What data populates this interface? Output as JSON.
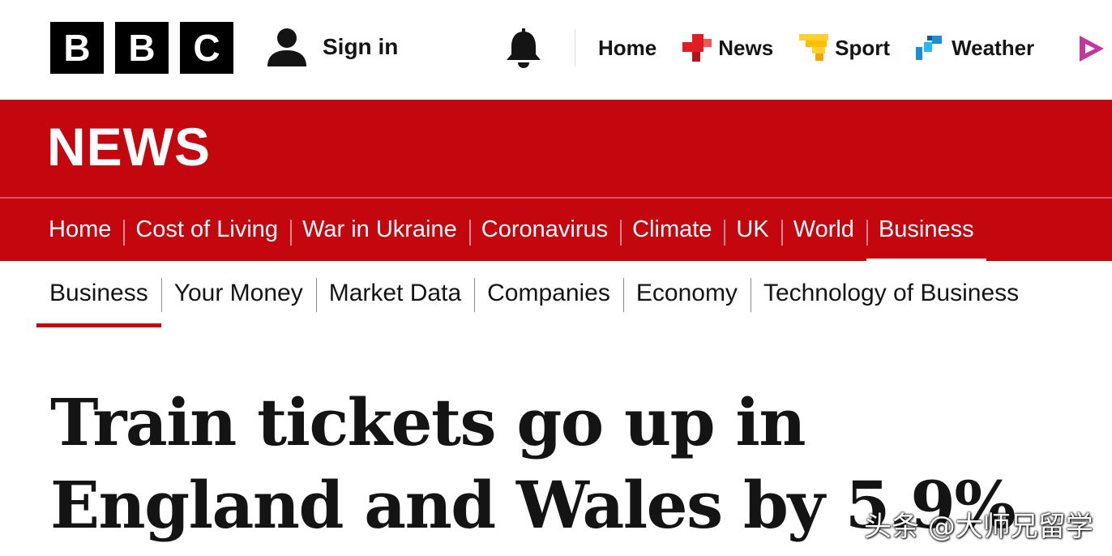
{
  "brand": {
    "letters": [
      "B",
      "B",
      "C"
    ]
  },
  "top_nav": {
    "sign_in": "Sign in",
    "items": [
      {
        "label": "Home",
        "icon": "none"
      },
      {
        "label": "News",
        "icon": "news-icon",
        "color": "#e31b23"
      },
      {
        "label": "Sport",
        "icon": "sport-icon",
        "color": "#ffd230"
      },
      {
        "label": "Weather",
        "icon": "weather-icon",
        "color": "#1c8fd1"
      }
    ],
    "more_icon_color": "#c3369c"
  },
  "masthead": {
    "title": "NEWS",
    "color": "#c4060e"
  },
  "main_nav": {
    "items": [
      "Home",
      "Cost of Living",
      "War in Ukraine",
      "Coronavirus",
      "Climate",
      "UK",
      "World",
      "Business"
    ],
    "active": "Business"
  },
  "sub_nav": {
    "items": [
      "Business",
      "Your Money",
      "Market Data",
      "Companies",
      "Economy",
      "Technology of Business"
    ],
    "active": "Business"
  },
  "article": {
    "headline": "Train tickets go up in England and Wales by 5.9%"
  },
  "watermark": "头条 @大师兄留学"
}
